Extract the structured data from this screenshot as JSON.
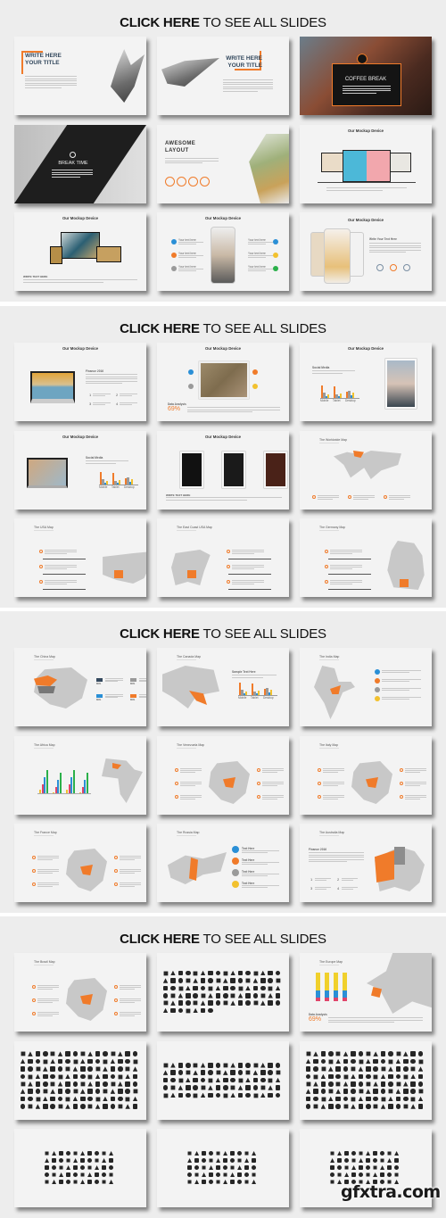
{
  "colors": {
    "accent": "#f07b2a",
    "navy": "#34495e",
    "blue": "#2a8fd6",
    "yellow": "#f2c12e",
    "green": "#2bb04a",
    "gray": "#9a9a9a",
    "dark": "#1c1c1c"
  },
  "sections": [
    {
      "cta_bold": "CLICK HERE",
      "cta_rest": "TO SEE ALL SLIDES",
      "slides": [
        {
          "type": "title-left",
          "title": "WRITE HERE YOUR TITLE"
        },
        {
          "type": "title-right",
          "title": "WRITE HERE YOUR TITLE"
        },
        {
          "type": "coffee",
          "title": "COFFEE BREAK",
          "icon": "coffee-cup-icon"
        },
        {
          "type": "break",
          "title": "BREAK TIME",
          "icon": "alarm-clock-icon"
        },
        {
          "type": "awesome",
          "title": "AWESOME LAYOUT"
        },
        {
          "type": "devices",
          "title": "Our Mockup Device"
        },
        {
          "type": "devices2",
          "title": "Our Mockup Device",
          "caption": "WRITE TEXT HERE"
        },
        {
          "type": "phone-features",
          "title": "Our Mockup Device",
          "items": [
            "Your text here",
            "Your text here",
            "Your text here",
            "Your text here",
            "Your text here",
            "Your text here"
          ]
        },
        {
          "type": "phones",
          "title": "Our Mockup Device",
          "subtitle": "Write Your Text Here"
        }
      ]
    },
    {
      "cta_bold": "CLICK HERE",
      "cta_rest": "TO SEE ALL SLIDES",
      "slides": [
        {
          "type": "imac",
          "title": "Our Mockup Device",
          "subtitle": "Finance 2016",
          "numbers": [
            "1",
            "2",
            "3",
            "4"
          ]
        },
        {
          "type": "tablet",
          "title": "Our Mockup Device",
          "label": "Data Analysis",
          "percent": "69%"
        },
        {
          "type": "chart-tablet",
          "title": "Our Mockup Device",
          "subtitle": "Social Media",
          "categories": [
            "Mobile",
            "Tablet",
            "Desktop"
          ]
        },
        {
          "type": "chart-laptop",
          "title": "Our Mockup Device",
          "subtitle": "Social Media",
          "categories": [
            "Mobile",
            "Tablet",
            "Desktop"
          ]
        },
        {
          "type": "tablets3",
          "title": "Our Mockup Device",
          "caption": "WRITE TEXT HERE"
        },
        {
          "type": "map-world",
          "title": "The Worldwide Map"
        },
        {
          "type": "map-list",
          "title": "The USA Map",
          "map": "usa"
        },
        {
          "type": "map-list",
          "title": "The East Coast USA Map",
          "map": "eastusa",
          "flip": true
        },
        {
          "type": "map-list",
          "title": "The Germany Map",
          "map": "germany"
        }
      ]
    },
    {
      "cta_bold": "CLICK HERE",
      "cta_rest": "TO SEE ALL SLIDES",
      "slides": [
        {
          "type": "map-legend",
          "title": "The China Map",
          "legend": [
            "80%",
            "80%",
            "80%",
            "80%"
          ]
        },
        {
          "type": "map-chart",
          "title": "The Canada Map",
          "subtitle": "Sample Text Here",
          "categories": [
            "Mobile",
            "Tablet",
            "Desktop"
          ]
        },
        {
          "type": "map-icons",
          "title": "The India Map"
        },
        {
          "type": "africa",
          "title": "The Africa Map"
        },
        {
          "type": "map-two",
          "title": "The Venezuela Map"
        },
        {
          "type": "map-two",
          "title": "The Italy Map"
        },
        {
          "type": "map-two",
          "title": "The France Map"
        },
        {
          "type": "map-text",
          "title": "The Russia Map",
          "items": [
            "Text Here",
            "Text Here",
            "Text Here",
            "Text Here"
          ]
        },
        {
          "type": "australia",
          "title": "The Australia Map",
          "subtitle": "Finance 2016",
          "numbers": [
            "1",
            "2",
            "3",
            "4"
          ]
        }
      ]
    },
    {
      "cta_bold": "CLICK HERE",
      "cta_rest": "TO SEE ALL SLIDES",
      "slides": [
        {
          "type": "map-two",
          "title": "The Brazil Map"
        },
        {
          "type": "icons",
          "rows": 6,
          "cols": 16
        },
        {
          "type": "europe",
          "title": "The Europe Map",
          "label": "Data Analysis",
          "percent": "69%"
        },
        {
          "type": "icons",
          "rows": 8,
          "cols": 16
        },
        {
          "type": "icons",
          "rows": 5,
          "cols": 16
        },
        {
          "type": "icons",
          "rows": 8,
          "cols": 16
        },
        {
          "type": "icons",
          "rows": 5,
          "cols": 10
        },
        {
          "type": "icons",
          "rows": 5,
          "cols": 10
        },
        {
          "type": "icons",
          "rows": 5,
          "cols": 10
        }
      ]
    }
  ],
  "watermark": "gfxtra.com"
}
